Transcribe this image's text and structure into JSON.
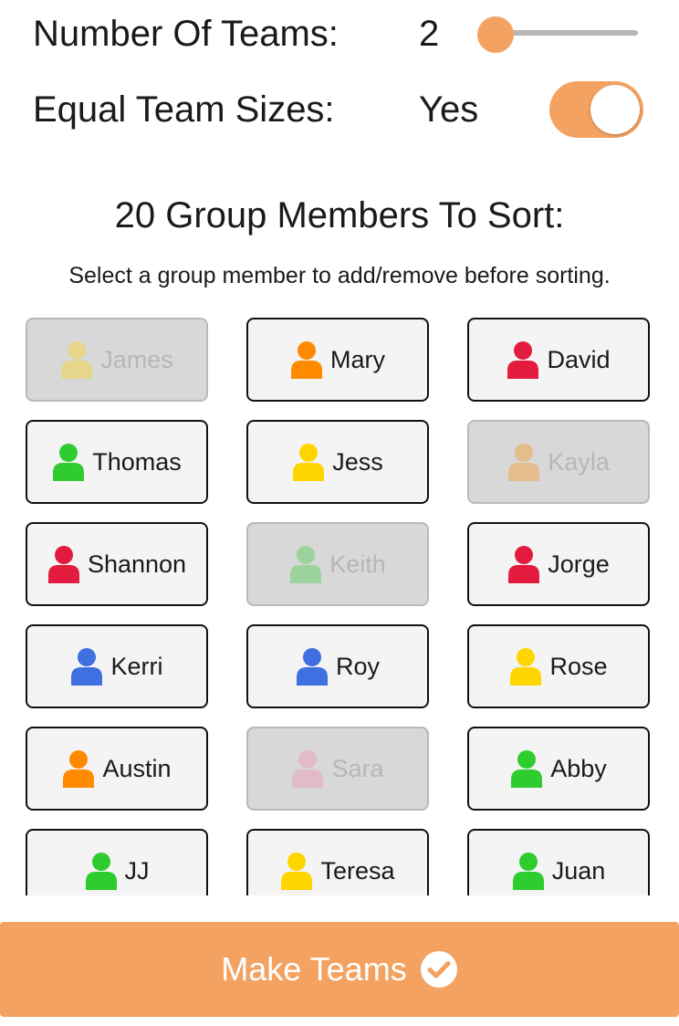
{
  "settings": {
    "teams_label": "Number Of Teams:",
    "teams_value": "2",
    "equal_label": "Equal Team Sizes:",
    "equal_value": "Yes",
    "equal_on": true
  },
  "heading": "20 Group Members To Sort:",
  "subheading": "Select a group member to add/remove before sorting.",
  "colors": {
    "accent": "#F4A261",
    "red": "#E31B3E",
    "orange": "#FF8A00",
    "yellow": "#FFD500",
    "green": "#2ECC2E",
    "blue": "#3F6FE0",
    "pink": "#F38BA8"
  },
  "members": [
    {
      "name": "James",
      "color": "yellow",
      "selected": false,
      "icon": "person-icon"
    },
    {
      "name": "Mary",
      "color": "orange",
      "selected": true,
      "icon": "person-icon"
    },
    {
      "name": "David",
      "color": "red",
      "selected": true,
      "icon": "person-icon"
    },
    {
      "name": "Thomas",
      "color": "green",
      "selected": true,
      "icon": "person-icon"
    },
    {
      "name": "Jess",
      "color": "yellow",
      "selected": true,
      "icon": "person-icon"
    },
    {
      "name": "Kayla",
      "color": "orange",
      "selected": false,
      "icon": "person-icon"
    },
    {
      "name": "Shannon",
      "color": "red",
      "selected": true,
      "icon": "person-icon"
    },
    {
      "name": "Keith",
      "color": "green",
      "selected": false,
      "icon": "person-icon"
    },
    {
      "name": "Jorge",
      "color": "red",
      "selected": true,
      "icon": "person-icon"
    },
    {
      "name": "Kerri",
      "color": "blue",
      "selected": true,
      "icon": "person-icon"
    },
    {
      "name": "Roy",
      "color": "blue",
      "selected": true,
      "icon": "person-icon"
    },
    {
      "name": "Rose",
      "color": "yellow",
      "selected": true,
      "icon": "person-icon"
    },
    {
      "name": "Austin",
      "color": "orange",
      "selected": true,
      "icon": "person-icon"
    },
    {
      "name": "Sara",
      "color": "pink",
      "selected": false,
      "icon": "person-icon"
    },
    {
      "name": "Abby",
      "color": "green",
      "selected": true,
      "icon": "person-icon"
    },
    {
      "name": "JJ",
      "color": "green",
      "selected": true,
      "icon": "person-icon"
    },
    {
      "name": "Teresa",
      "color": "yellow",
      "selected": true,
      "icon": "person-icon"
    },
    {
      "name": "Juan",
      "color": "green",
      "selected": true,
      "icon": "person-icon"
    }
  ],
  "make_button": {
    "label": "Make Teams",
    "icon": "check-circle-icon"
  }
}
